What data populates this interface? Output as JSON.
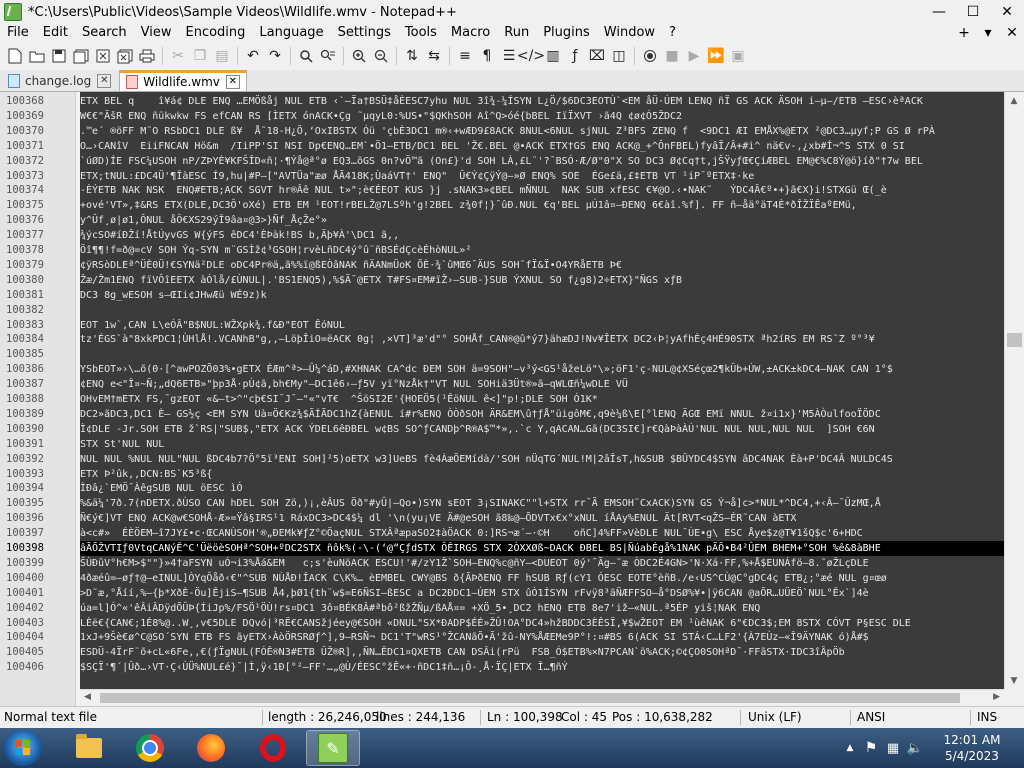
{
  "window": {
    "title": "*C:\\Users\\Public\\Videos\\Sample Videos\\Wildlife.wmv - Notepad++",
    "minimize": "—",
    "maximize": "☐",
    "close": "✕"
  },
  "menu": {
    "items": [
      "File",
      "Edit",
      "Search",
      "View",
      "Encoding",
      "Language",
      "Settings",
      "Tools",
      "Macro",
      "Run",
      "Plugins",
      "Window",
      "?"
    ],
    "right": [
      "+",
      "▾",
      "✕"
    ]
  },
  "toolbar": {
    "icons": [
      "new-file-icon",
      "open-file-icon",
      "save-icon",
      "save-all-icon",
      "close-icon",
      "close-all-icon",
      "print-icon",
      "cut-icon",
      "copy-icon",
      "paste-icon",
      "undo-icon",
      "redo-icon",
      "find-icon",
      "replace-icon",
      "zoom-in-icon",
      "zoom-out-icon",
      "sync-vertical-icon",
      "sync-horizontal-icon",
      "word-wrap-icon",
      "show-all-chars-icon",
      "indent-guide-icon",
      "html-tag-icon",
      "document-map-icon",
      "function-list-icon",
      "folder-workspace-icon",
      "monitoring-icon",
      "record-macro-icon",
      "stop-record-icon",
      "play-macro-icon",
      "run-macro-multiple-icon",
      "save-macro-icon"
    ]
  },
  "tabs": [
    {
      "label": "change.log",
      "active": false,
      "modified": false
    },
    {
      "label": "Wildlife.wmv",
      "active": true,
      "modified": true
    }
  ],
  "editor": {
    "current_line": "100398",
    "lines": [
      {
        "n": "100368",
        "t": "ETX BEL q    î¥á¢ DLE ENQ …EMÖßåj NUL ETB ‹`–Ïa†BSÜ‡åÈESC7yhu NUL 3î¾-¼ÍSYN L¿Ö/$6DC3EOTÙ`<EM åÜ·ÚEM LENQ ñÏ GS ACK ÄSOH i–µ–/ETB –ESC›èªACK"
      },
      {
        "n": "100369",
        "t": "W€€\"ÄšR ENQ ñükwkw FS efCAN RS [ÌETX ónACK•Çg ˜µqyL0:%US•\"$QKhSOH Aî^Q>óé{bBEL IïÏXVT ›ã4Q ¢ø¢Ó5ŽDC2"
      },
      {
        "n": "100370",
        "t": ".™e´ ®öFF M˜O RSbDC1 DLE ß¥  Å˜18-H¿Ö,‘OxIBSTX Óü 'çbÈ3DC1 m®‹+wÆD9£8ACK 8NUL<6NUL sjNUL Z³BFS ZENQ f  <9DC1 ÆI EMÅX%@ETX ²@DC3…µyf;P GS Ø rPÀ"
      },
      {
        "n": "100371",
        "t": "O…›CANîV  EiiFNCAN Hö&m  /IiPP'SI NSI Dp€ENQ…EM`•Ö1–ETB/DC1 BEL 'Ž€.BEL @•ACK ETX†GS ENQ ACK@_+^ÔnFBEL)fyâÏ/Â+#i^ nä€v-,¿xb#Í¬^S STX 0 SI"
      },
      {
        "n": "100372",
        "t": "`úØD)ÍE FSC¼USOH nP/ZÞYÈ¥KFŠÎD«ñ¦·¶Ýå@ª°ø EQ3…õGS 0n?vÖ™ã (On£}'d SOH LÀ,£L¨'?¯BSÓ·Æ/Ø\"0\"X SO DC3 Ø¢Cq†t,jŠŸyƒŒ€ÇiÆBEL EM@€%C8Ý@ö}íð\"†7w BEL"
      },
      {
        "n": "100373",
        "t": "ETX;tNUL:£DC4Ü'¶ÎàESC Í9,hu|#P–[\"AVTÜa\"æø ÅÃ418K;ÙaáVT†' ENQ\"  Û€Ý¢ÇÿÝ@–»Ø ENQ% SOE  ÉGe£ä,£‡ETB VT ¹iP¯ºETX‡·ke"
      },
      {
        "n": "100374",
        "t": "-ÈÝETB NAK NSK  ENQ#ETB;ACK SGVT hr®Âê NUL t»\";è€ÉEOT KUS }j .sNAK3»¢BEL mÑNUL  NAK SUB xfESC €¥@O.‹•NAK˜   ÝDC4Â€º•+}ã€X}i!STXGü Œ(_è"
      },
      {
        "n": "100375",
        "t": "+ové'VT»,‡&RS ETX(DLE,DC3Ô'oXé) ETB EM ¹EOT!rBELŽ@7LSºh'g!2BEL z¾0f¦}¯ûÐ.NUL €q'BEL µÚ1â¤–ÐENQ 6€àî.%f]. FF ñ–åä°äT4È*ðÎŽÏÊaºEMü,"
      },
      {
        "n": "100376",
        "t": "y^Ûf¸ø|ø1,ÔNUL åÔ€XS29ýÎ9âa¤@3>}Ñf_ÅçŽe°»"
      },
      {
        "n": "100377",
        "t": "¾ýcSO#íÐŽí!ÅtÚyvGS W{ýFS êDC4'ÈÞàk!BS b,Äþ¥À'\\DC1 ã,,"
      },
      {
        "n": "100378",
        "t": "Öî¶¶!f=ð@=cV SOH Ýq-SYN m¨GSÌž¢³GSOH¦rvèLñDC4ý°û¨ñBSÉdÇcèÉhòNUL»²"
      },
      {
        "n": "100379",
        "t": "¢ÿRSòDLEª^ÜÈ0Ü!€SYNä²DLE oDC4Pr®ä„ã%%ï@ßEÒâNAK ñÄANmÜoK ÕÈ·¾`ûMŒ6¯ÄUS SOH˜fÏ&Ï•O4YRåETB Þ€"
      },
      {
        "n": "100380",
        "t": "Žæ/Žm1ENQ fïVÔîEETX àÓlå/£ÙNUL|.'BS1ENQ5),%$Ä¯@ETX T#FS¤EM#ïŽ›–SUB-}SUB ÝXNUL SO f¿g8)2÷ETX}\"ÑGS xƒB"
      },
      {
        "n": "100381",
        "t": "DC3 8g_wESOH s–ŒIi¢JHwÆü WÉ9z)k"
      },
      {
        "n": "100382",
        "t": ""
      },
      {
        "n": "100383",
        "t": "EOT 1w`,CAN L\\eÓÂ\"B$NUL:WŽXpk¾.f&Ð\"EOT ÊóNUL"
      },
      {
        "n": "100384",
        "t": "tz'ÉGS`à\"8xkPDC1¦ÙHlÅ!.VCANhB\"g,,–LöþÎiO=ëACK 0g¦ ,×VT]³æ'd\"° SOHÅf_CAN®@û*ý7}ähæDJ!Nv¥ÎETX DC2‹Þ¦yAfhÈç4HÉ90STX ªh2íRS EM RS˜Z º°³¥"
      },
      {
        "n": "100385",
        "t": ""
      },
      {
        "n": "100386",
        "t": "YSbEOT»›\\…õ(0·[^awPOZÕ03%•gETX ÉÆm^ª>–Û¼^áD,#XHNAK CA^dc ÐEM SOH ä=9SOH\"–v³ý<GS¹åžeLö\"\\»;öF1'ç-NUL@¢XSéçœ2¶kÛb+ÚW,±ACK±kDC4–NAK CAN 1°$"
      },
      {
        "n": "100387",
        "t": "¢ENQ e<\"Î¤~Ñ;„dQ6ETB»\"þp3Å·pÙ¢ã,bh€My\"–DC1ê6›–ƒ5V yï°NzÅk†\"VT NUL SOHiä3Üt®»ã–qWLŒñ¼wDLE VÜ"
      },
      {
        "n": "100388",
        "t": "OHvEM†mETX FS‚¯gzEOT «&–t>^\"cþ€SI¯J¯–\"«\"vT€  ^ŠöSI2E'{HOEÖ5(¹ÊöNUL ê<]\"p!;DLE SOH Ó1K*"
      },
      {
        "n": "100389",
        "t": "DC2»ãDC3,DC1 È– GS½ç <EM SYN Uà¤Ö€Kz¾$ÃÍÃDC1hZ{àENUL í#r%ENQ ÒÒðSOH ÄR&EM\\û†ƒÅ\"üigôM€,q9è¼ß\\E[°lENQ ÄGŒ EMï NNUL ž¤i1x}'M5ÀÒulfooÏÖDC"
      },
      {
        "n": "100390",
        "t": "Ì¢DLE -Jr.SOH ETB ž`RS|\"SUB$,\"ETX ACK ÝDEL6êÐBEL w¢BS SO^ƒCANDþ^R®A$™*»,.`c Y,qACAN…Gã(DC3SI€]r€QàÞàÀÚ'NUL NUL NUL,NUL NUL  ]SOH €6N"
      },
      {
        "n": "100391",
        "t": "STX St'NUL NUL"
      },
      {
        "n": "100392",
        "t": "NUL NUL %NUL NUL\"NUL ßDC4b7?Ö°5ï³ENI SOH]²5)oETX w3]UeBS fè4ÀæÕEMídà/'SOH nÜqTG´NUL!M|2âÎsT,h&SUB $BÜYDC4$SYN âDC4NAK Èà+P'DC4Â NULDC4S"
      },
      {
        "n": "100393",
        "t": "ETX Þ²ûk,,DCN:BS`K5³ß{"
      },
      {
        "n": "100394",
        "t": "ÌÐâ¿`EMÖ¯ÀêgSUB NUL öESC ìÓ"
      },
      {
        "n": "100395",
        "t": "%&ä¼'7ð.7(nDETX.ðÙSO CAN hDEL SOH Zö,)¡,èÂUS Öð\"#yÛ|–Qo•)SYN sEOT 3¡SINAKC\"\"l+STX rr¯Ã EMSOH˜CxACK)SYN GS Ý¬å]c>*NUL*^DC4,+‹Â–¯ÛzMŒ,Å"
      },
      {
        "n": "100396",
        "t": "Ñ€ý€]VT ENQ ACK@w€SOHÅ-Æ»=Ÿâ§IRS¹1 RáxDC3>DC4$¼ dl '\\n(yu¡VE Ä#@eSOH ã8‰@–ÕDVTx€x°xNUL íÅAy%ENUL Ät[RVT<qŽS–ÉR˜CAN àETX"
      },
      {
        "n": "100397",
        "t": "à<c#»  ÉÈÖEM–î7JY£•c·ŒCANÙSOH'®„ÐEMk¥ƒZ°©ÖaçNUL STXÂªæpaSO2‡àÖACK 0:]RS¬æ´–·©H    oñC]4%FF»VèDLE NUL¯ÙE•g\\ ESC Åye$z@T¥1šQ$c'6+HDC"
      },
      {
        "n": "100398",
        "t": "âÃÕŽVTIƒ0VtqCANýÊ^C'ÜëöèSOHª^SOH+ºDC2STX ñôk%(-\\-(‘@“ÇƒdSTX ÔÊIRGS STX 2ÒXXØß~DACK ÐBEL BS|ÑúabÉgå%1NAK pÃÕ•B4²ÛEM BHEM+°SOH %ê&8àBHE"
      },
      {
        "n": "100399",
        "t": "ŠÙÐûV°h€M>$\"\"}»4†aFSYN uÓ¬i3%Åá&EM   c;s'èuNöACK ESCU!'#/zY1Ž`SOH–ENQ%c@ñY–<DUEOT 0ý'¯Ãg–˜æ ÒDC2É4GN>'N·Xá·FF,%+Å$EUNÁfö–8.˜øŽLçDLE"
      },
      {
        "n": "100400",
        "t": "4ðæéû=–øƒ†@–eINUL]ÒYqÔåð‹€\"^SUB NÙÅÐ!ÎACK C\\K%… èEMBEL CWY@BS ð{ÃÞðENQ FF hSUB Rƒ(cY1 ÓESC EOTE°èñB./e‹US^CÙ@C°gDC4ç ETB¿;°æé NUL g¤œø"
      },
      {
        "n": "100401",
        "t": ">D˜æ,°Åíí,%–{þ*XðÈ-Öu]ÊjiS–¶SUB Å4,þØ1{th¨w$=E6ÑSI–ßESC a DC2ÐDC1–ÚEM STX ûÒ1ÍSYN rFvÿ8³ãÑÆFFSO–å°DSØ%¥•|ÿ6CAN @aÕR…UÜEÖ`NUL°Êx`]4è"
      },
      {
        "n": "100402",
        "t": "úa=l]Ó^«'êÂiÂDÿdÕÛÞ{ÍiJp%/FSÖ¹ÖÙ!rs¤DC1 3ô¤BÉK8Â#ªbô²ßžŽÑµ/ßAÅ¤= +XÖ_5•¸DC2 hENQ ETB 8e7'iž–«NUL.ª5ÉP yiš¦NAK ENQ"
      },
      {
        "n": "100403",
        "t": "LÈë€{CAN€;1É8%@..W¸,v€5DLE DQvó|³RË€CANSžjéey@€SOH «DNUL\"SX*ÐADP$ÉÉ»ŽÛ!OA°DC4»hžBDDC3ÈÊSÏ,¥$wŽEOT EM ¹ùêNAK 6\"€DC3$;EM 8STX CÓVT P§ESC DLE"
      },
      {
        "n": "100404",
        "t": "1xJ+9Šè€ø^C@SO´SYN ETB FS ãyETX›ÀòÖRSRØƒ^],9–RSÑ¬ DC1'T\"wRS¹°ŽCANãÕ•Ã'žû-NY%ÅÆEMe9P°!:¤#BS 6(ACK SI STÁ‹C…LF2'{À7EÙz–«Î9ÄYNAK ó)Å#$"
      },
      {
        "n": "100405",
        "t": "ESDÜ-4ÏrF¨õ+cL«6Fe,,€(ƒÏgNUL(FÓÊ®N3#ETB ÛŽ®R],,ÑN…ÊDC1¤QXETB CAN DSÂi(rPü  FSB_Ó$ETB%×N7PCAN`ö%ACK;©¢ÇO0SOHªD¯·FFãSTX·IDC3îÂpÖb"
      },
      {
        "n": "100406",
        "t": "$SÇÏ'¶´|Ûð…›VT·Ç‹ÙÜ%NUL£é}¯|Ì,ÿ‹1Ð[°²–FF'…„@Ù/ÉESC°žÊ«+·ñDC1‡ñ…¡Ô-¸Å·ÏÇ|ETX Î…¶ñÝ"
      }
    ]
  },
  "status": {
    "type": "Normal text file",
    "length": "length : 26,246,050",
    "lines": "lines : 244,136",
    "ln": "Ln : 100,398",
    "col": "Col : 45",
    "pos": "Pos : 10,638,282",
    "eol": "Unix (LF)",
    "encoding": "ANSI",
    "mode": "INS"
  },
  "taskbar": {
    "apps": [
      "windows-explorer",
      "google-chrome",
      "firefox",
      "opera",
      "notepad-plus-plus"
    ],
    "active_app": "notepad-plus-plus",
    "tray_arrow": "▲",
    "time": "12:01 AM",
    "date": "5/4/2023"
  },
  "colors": {
    "editor_bg": "#3b3b3b",
    "editor_fg": "#e6e6e6",
    "current_line_bg": "#000000",
    "gutter_bg": "#e4e4e4",
    "tab_accent": "#f0a030"
  }
}
